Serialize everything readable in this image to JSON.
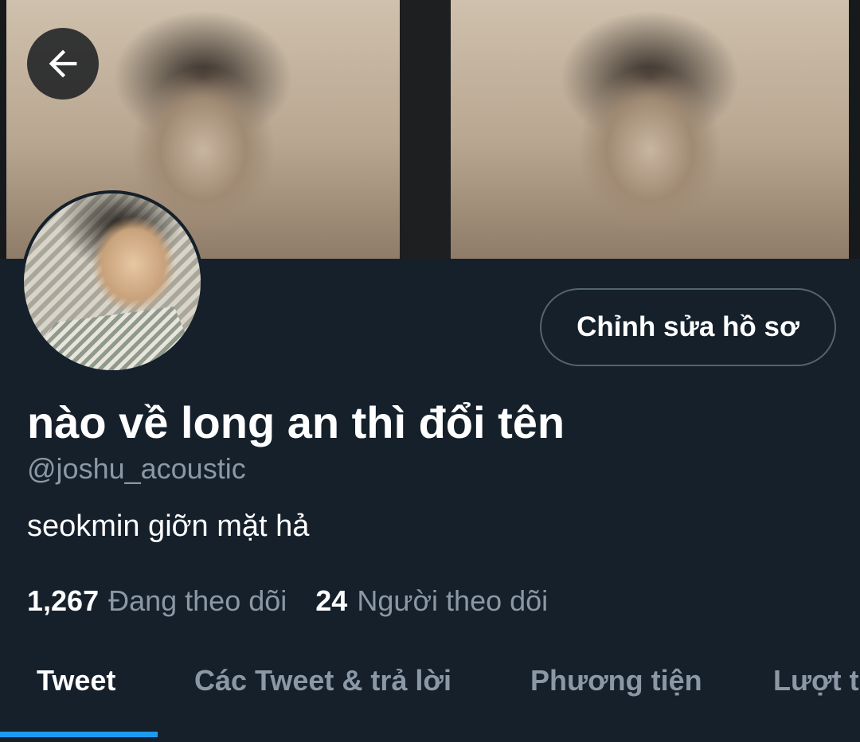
{
  "header": {
    "back_icon": "arrow-left-icon"
  },
  "profile": {
    "edit_button_label": "Chỉnh sửa hồ sơ",
    "display_name": "nào về long an thì đổi tên",
    "handle": "@joshu_acoustic",
    "bio": "seokmin giỡn mặt hả",
    "following_count": "1,267",
    "following_label": "Đang theo dõi",
    "followers_count": "24",
    "followers_label": "Người theo dõi"
  },
  "tabs": [
    {
      "label": "Tweet",
      "active": true
    },
    {
      "label": "Các Tweet & trả lời",
      "active": false
    },
    {
      "label": "Phương tiện",
      "active": false
    },
    {
      "label": "Lượt thích",
      "active": false
    }
  ],
  "colors": {
    "background": "#15202b",
    "accent": "#1d9bf0",
    "secondary_text": "#8b98a5",
    "button_border": "#536471"
  }
}
